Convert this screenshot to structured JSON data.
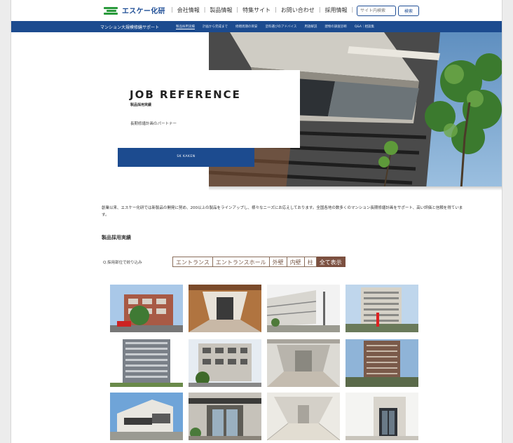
{
  "header": {
    "logo_text": "エスケー化研",
    "nav": [
      "会社情報",
      "製品情報",
      "特集サイト",
      "お問い合わせ",
      "採用情報"
    ],
    "search_placeholder": "サイト内検索",
    "search_button": "検索"
  },
  "subnav": {
    "site_label": "マンション大規模修繕サポート",
    "items": [
      "製品採用実績",
      "計画から完成まで",
      "修繕周期の目安",
      "塗料選びのアドバイス",
      "用語解説",
      "建物の調査診断",
      "Q&A｜相談集"
    ],
    "active_index": 0
  },
  "hero": {
    "title": "JOB REFERENCE",
    "subtitle": "製品採用実績",
    "tagline": "長期修繕計画のパートナー",
    "banner_label": "SK KAKEN"
  },
  "intro": {
    "text": "創業以来、エスケー化研では新製品の開発に努め、200以上の製品をラインアップし、様々なニーズにお応えしております。全国各地の数多くのマンション長期修繕計画をサポート、高い評価と信頼を得ています。"
  },
  "section": {
    "title": "製品採用実績",
    "filter_label": "Q.採用部位で絞り込み",
    "filters": [
      "エントランス",
      "エントランスホール",
      "外壁",
      "内壁",
      "柱",
      "全て表示"
    ],
    "active_filter": 5
  },
  "gallery": {
    "images": [
      "brick-apartment-with-tree",
      "entrance-hall-warm",
      "white-low-rise-building",
      "tall-apartment-tower",
      "high-rise-grey-block",
      "mid-rise-apartment",
      "interior-lobby",
      "brown-tower-building",
      "modern-white-house",
      "entrance-canopy",
      "bright-corridor",
      "glass-entrance-door"
    ]
  },
  "colors": {
    "brand_blue": "#1c4b8f",
    "brand_green": "#2a9a3c",
    "filter_brown": "#7c5040"
  }
}
